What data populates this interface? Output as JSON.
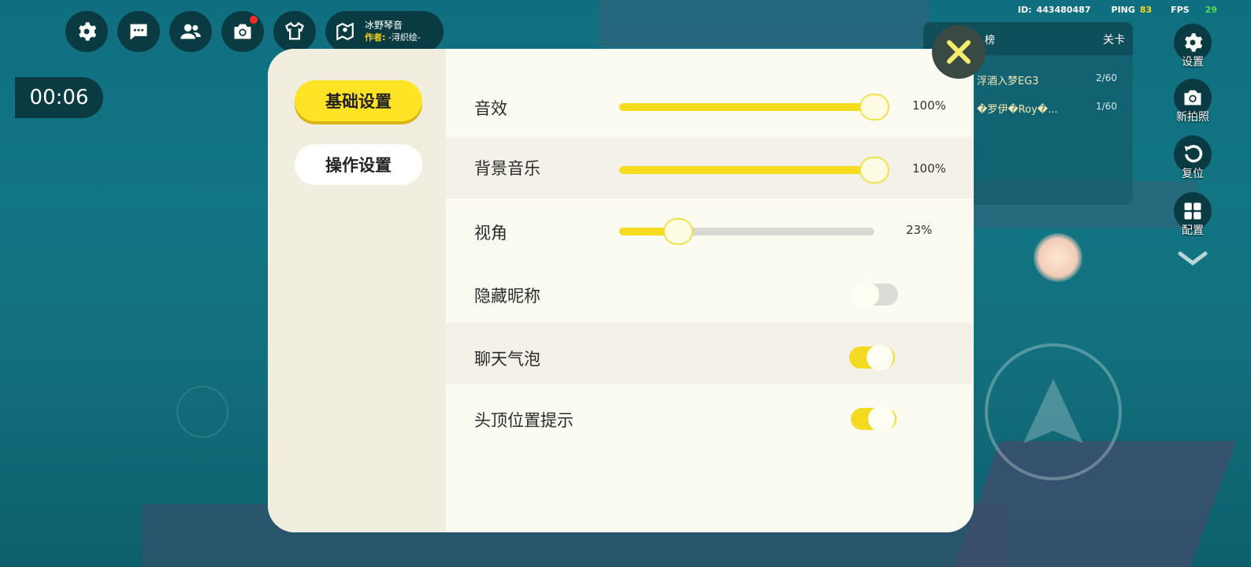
{
  "stats": {
    "id_label": "ID:",
    "id_value": "443480487",
    "ping_label": "PING",
    "ping_value": "83",
    "fps_label": "FPS",
    "fps_value": "29"
  },
  "toolbar": {
    "map_title": "冰野琴音",
    "author_label": "作者:",
    "author_name": "-浔织绘-"
  },
  "timer": "00:06",
  "leaderboard": {
    "header_left": "榜",
    "header_right": "关卡",
    "rows": [
      {
        "name": "浮酒入梦EG3",
        "score": "2/60"
      },
      {
        "name": "�罗伊�Roy�...",
        "score": "1/60"
      }
    ]
  },
  "side_actions": [
    {
      "label": "设置",
      "icon": "gear-icon"
    },
    {
      "label": "新拍照",
      "icon": "camera-icon"
    },
    {
      "label": "复位",
      "icon": "reset-icon"
    },
    {
      "label": "配置",
      "icon": "grid-icon"
    }
  ],
  "settings": {
    "tabs": [
      "基础设置",
      "操作设置"
    ],
    "active_tab": "基础设置",
    "sliders": [
      {
        "label": "音效",
        "value": 100,
        "display": "100%"
      },
      {
        "label": "背景音乐",
        "value": 100,
        "display": "100%"
      },
      {
        "label": "视角",
        "value": 23,
        "display": "23%"
      }
    ],
    "toggles": [
      {
        "label": "隐藏昵称",
        "on": false
      },
      {
        "label": "聊天气泡",
        "on": true
      },
      {
        "label": "头顶位置提示",
        "on": true
      }
    ]
  },
  "colors": {
    "accent": "#ffe324",
    "panel": "#fcfbf1",
    "dark_button": "#0a3a42"
  }
}
